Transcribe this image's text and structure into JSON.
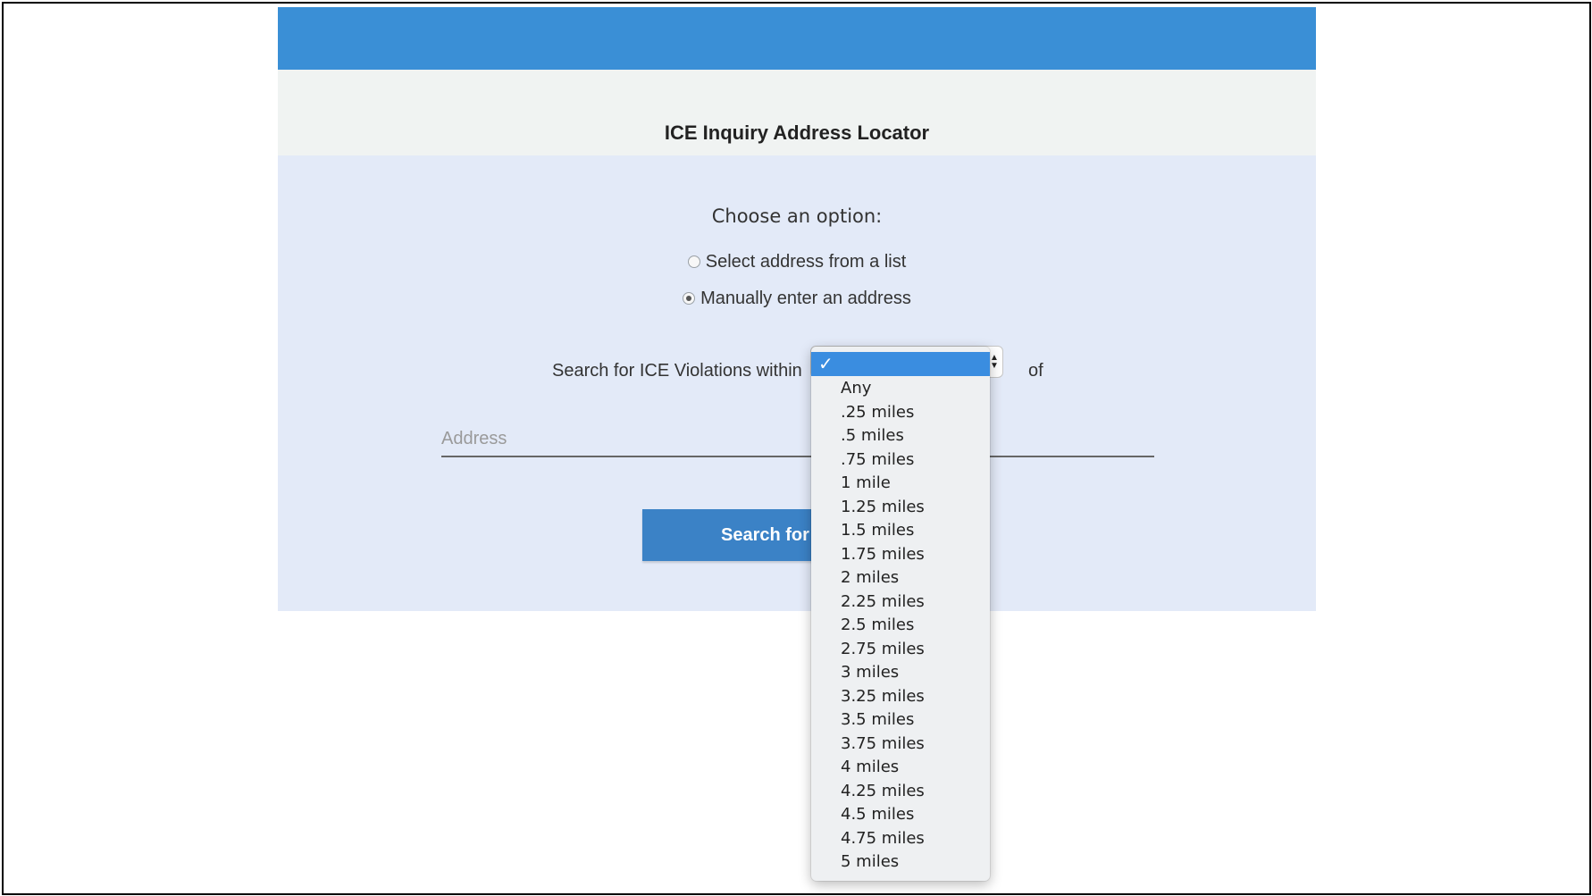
{
  "header": {
    "title": "ICE Inquiry Address Locator"
  },
  "form": {
    "choose_label": "Choose an option:",
    "options": [
      {
        "label": "Select address from a list",
        "checked": false
      },
      {
        "label": "Manually enter an address",
        "checked": true
      }
    ],
    "search_within_label": "Search for ICE Violations within",
    "of_label": "of",
    "address_placeholder": "Address",
    "search_button_visible_label": "Search for I"
  },
  "distance_select": {
    "selected_value": "",
    "selected_marker": "✓",
    "options": [
      "Any",
      ".25 miles",
      ".5 miles",
      ".75 miles",
      "1 mile",
      "1.25 miles",
      "1.5 miles",
      "1.75 miles",
      "2 miles",
      "2.25 miles",
      "2.5 miles",
      "2.75 miles",
      "3 miles",
      "3.25 miles",
      "3.5 miles",
      "3.75 miles",
      "4 miles",
      "4.25 miles",
      "4.5 miles",
      "4.75 miles",
      "5 miles"
    ]
  },
  "colors": {
    "topbar": "#3a8fd6",
    "panel": "#e3eaf8",
    "button": "#3b82c6",
    "menu_highlight": "#3a8de0"
  }
}
